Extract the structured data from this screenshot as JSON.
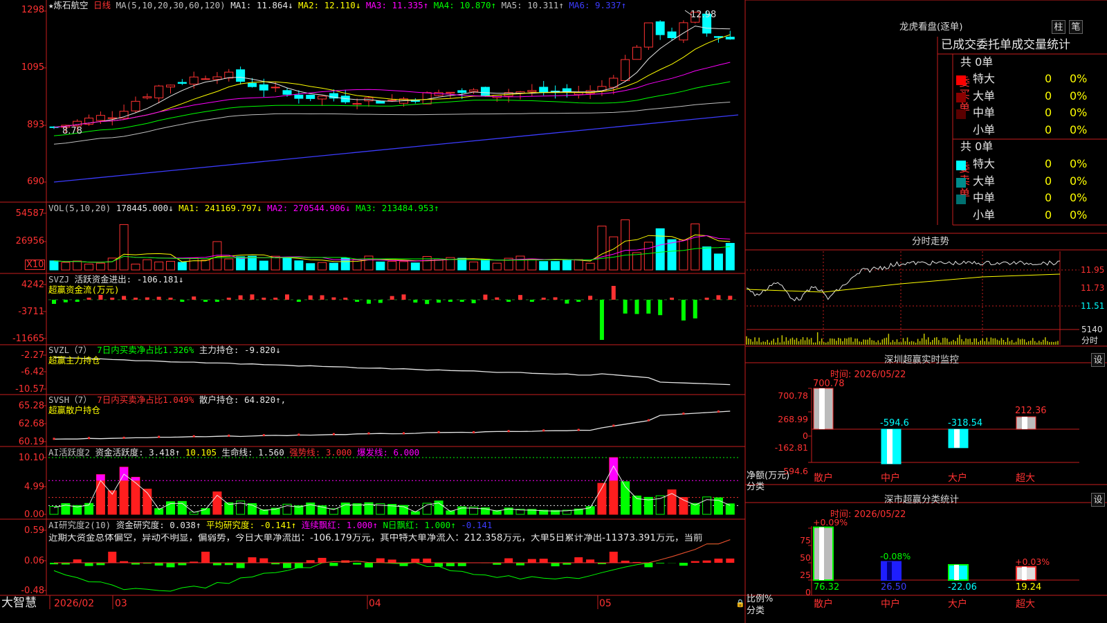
{
  "stock": {
    "name": "★炼石航空",
    "period": "日线"
  },
  "kline_header": {
    "ma_params": "MA(5,10,20,30,60,120)",
    "ma1": "MA1: 11.864↓",
    "ma2": "MA2: 12.110↓",
    "ma3": "MA3: 11.335↑",
    "ma4": "MA4: 10.870↑",
    "ma5": "MA5: 10.311↑",
    "ma6": "MA6: 9.337↑",
    "high_marker": "12.98",
    "low_marker": "8.78",
    "y_ticks": [
      "1298",
      "1095",
      "893",
      "690"
    ]
  },
  "vol_header": {
    "label": "VOL(5,10,20)",
    "value": "178445.000↓",
    "ma1": "MA1: 241169.797↓",
    "ma2": "MA2: 270544.906↓",
    "ma3": "MA3: 213484.953↑",
    "y_ticks": [
      "54587",
      "26956"
    ],
    "unit": "X10"
  },
  "svzj": {
    "label": "SVZJ",
    "reading": "活跃资金进出: -106.181↓",
    "title": "超赢资金流(万元)",
    "y_ticks": [
      "4242",
      "-3711",
      "-11665"
    ]
  },
  "svzl": {
    "label": "SVZL（7）",
    "ratio": "7日内买卖净占比1.326%",
    "reading": "主力持仓: -9.820↓",
    "title": "超赢主力持仓",
    "y_ticks": [
      "-2.27",
      "-6.42",
      "-10.57"
    ]
  },
  "svsh": {
    "label": "SVSH（7）",
    "ratio": "7日内买卖净占比1.049%",
    "reading": "散户持仓: 64.820↑,",
    "title": "超赢散户持仓",
    "y_ticks": [
      "65.28",
      "62.68",
      "60.19"
    ]
  },
  "ai_active": {
    "label": "AI活跃度2",
    "reading": "资金活跃度: 3.418↑",
    "value2": "10.105",
    "life": "生命线: 1.560",
    "strong": "强势线: 3.000",
    "burst": "爆发线: 6.000",
    "y_ticks": [
      "10.10",
      "4.99",
      "0.00"
    ]
  },
  "ai_research": {
    "label": "AI研究度2(10)",
    "reading": "资金研究度: 0.038↑",
    "avg": "平均研究度: -0.141↑",
    "red_streak": "连续飘红: 1.000↑",
    "red_days": "N日飘红: 1.000↑",
    "extra": "-0.141",
    "y_ticks": [
      "0.59",
      "0.06",
      "-0.48"
    ]
  },
  "commentary": "近期大资金总体偏空，异动不明显，偏弱势，今日大单净流出：-106.179万元，其中特大单净流入：212.358万元，大单5日累计净出-11373.391万元，当前",
  "date_axis": {
    "brand": "大智慧",
    "start": "2026/02",
    "m3": "03",
    "m4": "04",
    "m5": "05"
  },
  "dragon": {
    "title": "龙虎看盘(逐单)",
    "btn_bar": "柱",
    "btn_tick": "笔",
    "stats_title": "已成交委托单成交量统计",
    "buy": {
      "label": "委买单",
      "total": "共 0单",
      "rows": [
        {
          "name": "特大",
          "count": "0",
          "pct": "0%",
          "color": "#ff0000"
        },
        {
          "name": "大单",
          "count": "0",
          "pct": "0%",
          "color": "#8b0000"
        },
        {
          "name": "中单",
          "count": "0",
          "pct": "0%",
          "color": "#5a0000"
        },
        {
          "name": "小单",
          "count": "0",
          "pct": "0%",
          "color": "#000000"
        }
      ]
    },
    "sell": {
      "label": "委卖单",
      "total": "共 0单",
      "rows": [
        {
          "name": "特大",
          "count": "0",
          "pct": "0%",
          "color": "#00ffff"
        },
        {
          "name": "大单",
          "count": "0",
          "pct": "0%",
          "color": "#008b8b"
        },
        {
          "name": "中单",
          "count": "0",
          "pct": "0%",
          "color": "#007070"
        },
        {
          "name": "小单",
          "count": "0",
          "pct": "0%",
          "color": "#000000"
        }
      ]
    }
  },
  "intraday": {
    "title": "分时走势",
    "ticks": [
      "11.95",
      "11.73",
      "11.51"
    ],
    "vol_tick": "5140",
    "vol_label": "分时"
  },
  "sz_monitor": {
    "title": "深圳超赢实时监控",
    "btn": "设",
    "time": "时间: 2026/05/22",
    "y_ticks": [
      "700.78",
      "268.99",
      "0",
      "-162.81",
      "-594.6"
    ],
    "ylabel": "净额(万元)",
    "xlabel": "分类",
    "categories": [
      "散户",
      "中户",
      "大户",
      "超大"
    ],
    "values": [
      700.78,
      -594.6,
      -318.54,
      212.36
    ],
    "value_labels": [
      "700.78",
      "-594.6",
      "-318.54",
      "212.36"
    ]
  },
  "sz_class": {
    "title": "深市超赢分类统计",
    "btn": "设",
    "time": "时间: 2026/05/22",
    "y_ticks": [
      "75",
      "50",
      "25",
      "0"
    ],
    "ylabel": "比例%",
    "xlabel": "分类",
    "categories": [
      "散户",
      "中户",
      "大户",
      "超大"
    ],
    "top_labels": [
      "+0.09%",
      "-0.08%",
      "",
      "+0.03%"
    ],
    "values": [
      "76.32",
      "26.50",
      "-22.06",
      "19.24"
    ]
  }
}
